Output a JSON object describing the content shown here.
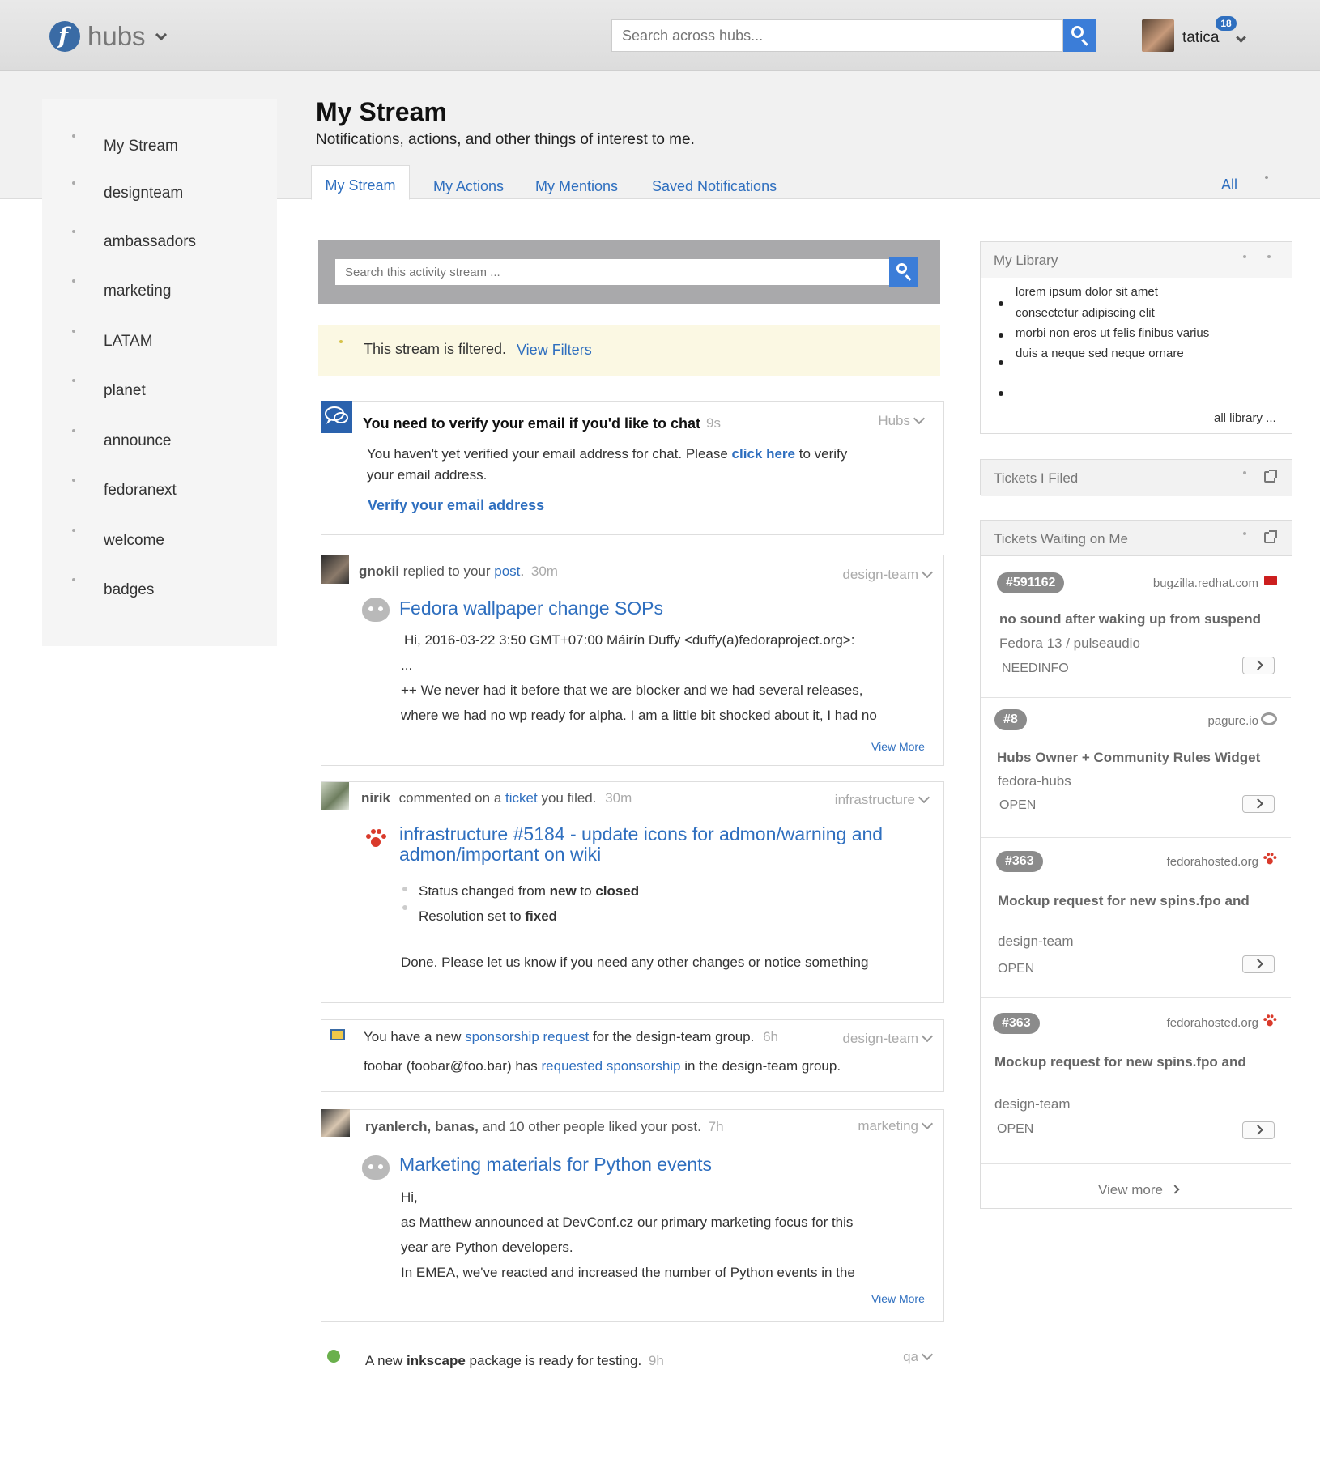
{
  "header": {
    "brand": "hubs",
    "search_placeholder": "Search across hubs...",
    "username": "tatica",
    "notification_count": "18"
  },
  "sidebar": {
    "items": [
      {
        "label": "My Stream"
      },
      {
        "label": "designteam"
      },
      {
        "label": "ambassadors"
      },
      {
        "label": "marketing"
      },
      {
        "label": "LATAM"
      },
      {
        "label": "planet"
      },
      {
        "label": "announce"
      },
      {
        "label": "fedoranext"
      },
      {
        "label": "welcome"
      },
      {
        "label": "badges"
      }
    ]
  },
  "page": {
    "title": "My Stream",
    "subtitle": "Notifications, actions, and other things of interest to me.",
    "tabs": [
      "My Stream",
      "My Actions",
      "My Mentions",
      "Saved Notifications"
    ],
    "filter_label": "All"
  },
  "stream": {
    "search_placeholder": "Search this activity stream ...",
    "filtered_text": "This stream is filtered.",
    "view_filters": "View Filters",
    "verify": {
      "title": "You need to verify your email if you'd like to chat",
      "time": "9s",
      "tag": "Hubs",
      "text_before": "You haven't yet verified your email address for chat. Please",
      "link": "click here",
      "text_after": "to verify",
      "text_line2": "your email address.",
      "action": "Verify your email address"
    },
    "post1": {
      "user": "gnokii",
      "action": "replied to your",
      "link": "post",
      "period": ".",
      "time": "30m",
      "tag": "design-team",
      "title": "Fedora wallpaper change SOPs",
      "lines": [
        "Hi, 2016-03-22 3:50 GMT+07:00 Máirín Duffy <duffy(a)fedoraproject.org>:",
        "...",
        "++ We never had it before that we are blocker and we had several releases,",
        "where we had no wp ready for alpha. I am a little bit shocked about it, I had no"
      ],
      "view_more": "View More"
    },
    "post2": {
      "user": "nirik",
      "action": "commented on a",
      "link": "ticket",
      "action2": "you filed.",
      "time": "30m",
      "tag": "infrastructure",
      "title_line1": "infrastructure #5184 - update icons for admon/warning and",
      "title_line2": "admon/important on wiki",
      "status_pre": "Status changed from",
      "status_from": "new",
      "status_mid": "to",
      "status_to": "closed",
      "resolution_pre": "Resolution set to",
      "resolution": "fixed",
      "comment": "Done. Please let us know if you need any other changes or notice something"
    },
    "post3": {
      "text_pre": "You have a new",
      "link": "sponsorship request",
      "text_post": "for the design-team group.",
      "time": "6h",
      "tag": "design-team",
      "line2_pre": "foobar (foobar@foo.bar) has",
      "line2_link": "requested sponsorship",
      "line2_post": "in the design-team group."
    },
    "post4": {
      "users": "ryanlerch, banas,",
      "action": "and 10 other people liked your post.",
      "time": "7h",
      "tag": "marketing",
      "title": "Marketing materials for Python events",
      "lines": [
        "Hi,",
        "as Matthew announced at DevConf.cz our primary marketing focus for this",
        "year are Python developers.",
        "In EMEA, we've reacted and increased the number of Python events in the"
      ],
      "view_more": "View More"
    },
    "post5": {
      "pre": "A new",
      "pkg": "inkscape",
      "post": "package is ready for testing.",
      "time": "9h",
      "tag": "qa"
    }
  },
  "library": {
    "title": "My Library",
    "items": [
      "lorem ipsum dolor sit amet",
      "consectetur adipiscing elit",
      "morbi non eros ut felis finibus varius",
      "duis a neque sed neque ornare"
    ],
    "all_link": "all library ..."
  },
  "tickets_filed": {
    "title": "Tickets I Filed"
  },
  "tickets_waiting": {
    "title": "Tickets Waiting on Me",
    "items": [
      {
        "id": "#591162",
        "source": "bugzilla.redhat.com",
        "title": "no sound after waking up from suspend",
        "sub": "Fedora 13 / pulseaudio",
        "status": "NEEDINFO"
      },
      {
        "id": "#8",
        "source": "pagure.io",
        "title": "Hubs Owner + Community Rules Widget",
        "sub": "fedora-hubs",
        "status": "OPEN"
      },
      {
        "id": "#363",
        "source": "fedorahosted.org",
        "title": "Mockup request for new spins.fpo and",
        "sub": "design-team",
        "status": "OPEN"
      },
      {
        "id": "#363",
        "source": "fedorahosted.org",
        "title": "Mockup request for new spins.fpo and",
        "sub": "design-team",
        "status": "OPEN"
      }
    ],
    "view_more": "View more"
  },
  "colors": {
    "accent": "#2f6fbf",
    "search_button": "#3b7dd8",
    "chat_icon": "#2a62ad"
  }
}
